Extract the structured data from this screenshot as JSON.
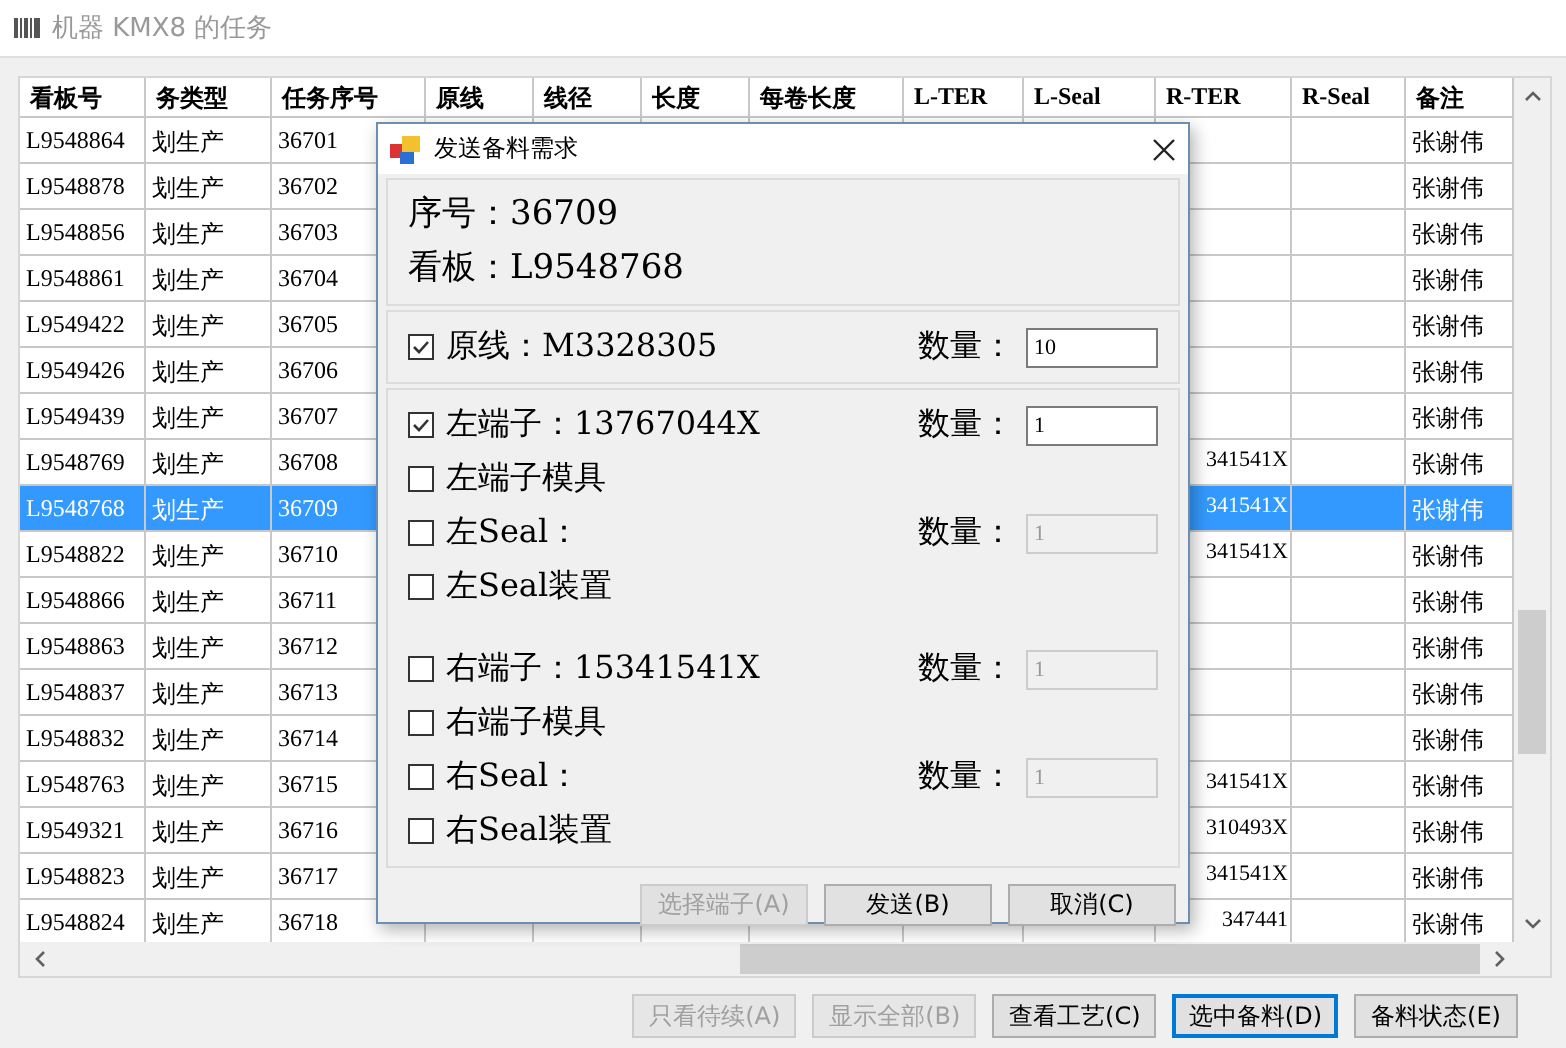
{
  "window": {
    "title": "机器 KMX8 的任务"
  },
  "table": {
    "columns": [
      "看板号",
      "务类型",
      "任务序号",
      "原线",
      "线径",
      "长度",
      "每卷长度",
      "L-TER",
      "L-Seal",
      "R-TER",
      "R-Seal",
      "备注"
    ],
    "rows": [
      {
        "kanban": "L9548864",
        "type": "划生产",
        "seq": "36701",
        "remark": "张谢伟",
        "selected": false
      },
      {
        "kanban": "L9548878",
        "type": "划生产",
        "seq": "36702",
        "remark": "张谢伟",
        "selected": false
      },
      {
        "kanban": "L9548856",
        "type": "划生产",
        "seq": "36703",
        "remark": "张谢伟",
        "selected": false
      },
      {
        "kanban": "L9548861",
        "type": "划生产",
        "seq": "36704",
        "remark": "张谢伟",
        "selected": false
      },
      {
        "kanban": "L9549422",
        "type": "划生产",
        "seq": "36705",
        "remark": "张谢伟",
        "selected": false
      },
      {
        "kanban": "L9549426",
        "type": "划生产",
        "seq": "36706",
        "remark": "张谢伟",
        "selected": false
      },
      {
        "kanban": "L9549439",
        "type": "划生产",
        "seq": "36707",
        "remark": "张谢伟",
        "selected": false
      },
      {
        "kanban": "L9548769",
        "type": "划生产",
        "seq": "36708",
        "r_ter": "341541X",
        "remark": "张谢伟",
        "selected": false
      },
      {
        "kanban": "L9548768",
        "type": "划生产",
        "seq": "36709",
        "r_ter": "341541X",
        "remark": "张谢伟",
        "selected": true
      },
      {
        "kanban": "L9548822",
        "type": "划生产",
        "seq": "36710",
        "r_ter": "341541X",
        "remark": "张谢伟",
        "selected": false
      },
      {
        "kanban": "L9548866",
        "type": "划生产",
        "seq": "36711",
        "remark": "张谢伟",
        "selected": false
      },
      {
        "kanban": "L9548863",
        "type": "划生产",
        "seq": "36712",
        "remark": "张谢伟",
        "selected": false
      },
      {
        "kanban": "L9548837",
        "type": "划生产",
        "seq": "36713",
        "remark": "张谢伟",
        "selected": false
      },
      {
        "kanban": "L9548832",
        "type": "划生产",
        "seq": "36714",
        "remark": "张谢伟",
        "selected": false
      },
      {
        "kanban": "L9548763",
        "type": "划生产",
        "seq": "36715",
        "r_ter": "341541X",
        "remark": "张谢伟",
        "selected": false
      },
      {
        "kanban": "L9549321",
        "type": "划生产",
        "seq": "36716",
        "r_ter": "310493X",
        "remark": "张谢伟",
        "selected": false
      },
      {
        "kanban": "L9548823",
        "type": "划生产",
        "seq": "36717",
        "r_ter": "341541X",
        "remark": "张谢伟",
        "selected": false
      },
      {
        "kanban": "L9548824",
        "type": "划生产",
        "seq": "36718",
        "r_ter": "347441",
        "remark": "张谢伟",
        "selected": false
      }
    ]
  },
  "dialog": {
    "title": "发送备料需求",
    "info": [
      "序号：36709",
      "看板：L9548768"
    ],
    "groups": [
      {
        "sections": [
          [
            {
              "label": "原线：M3328305",
              "checked": true,
              "qty_label": "数量：",
              "qty": "10",
              "qty_disabled": false
            }
          ]
        ]
      },
      {
        "sections": [
          [
            {
              "label": "左端子：13767044X",
              "checked": true,
              "qty_label": "数量：",
              "qty": "1",
              "qty_disabled": false
            },
            {
              "label": "左端子模具",
              "checked": false
            },
            {
              "label": "左Seal：",
              "checked": false,
              "qty_label": "数量：",
              "qty": "1",
              "qty_disabled": true
            },
            {
              "label": "左Seal装置",
              "checked": false
            }
          ],
          [
            {
              "label": "右端子：15341541X",
              "checked": false,
              "qty_label": "数量：",
              "qty": "1",
              "qty_disabled": true
            },
            {
              "label": "右端子模具",
              "checked": false
            },
            {
              "label": "右Seal：",
              "checked": false,
              "qty_label": "数量：",
              "qty": "1",
              "qty_disabled": true
            },
            {
              "label": "右Seal装置",
              "checked": false
            }
          ]
        ]
      }
    ],
    "buttons": [
      {
        "label": "选择端子(A)",
        "disabled": true
      },
      {
        "label": "发送(B)",
        "disabled": false
      },
      {
        "label": "取消(C)",
        "disabled": false
      }
    ]
  },
  "buttons": [
    {
      "label": "只看待续(A)",
      "disabled": true,
      "default": false
    },
    {
      "label": "显示全部(B)",
      "disabled": true,
      "default": false
    },
    {
      "label": "查看工艺(C)",
      "disabled": false,
      "default": false
    },
    {
      "label": "选中备料(D)",
      "disabled": false,
      "default": true
    },
    {
      "label": "备料状态(E)",
      "disabled": false,
      "default": false
    }
  ]
}
